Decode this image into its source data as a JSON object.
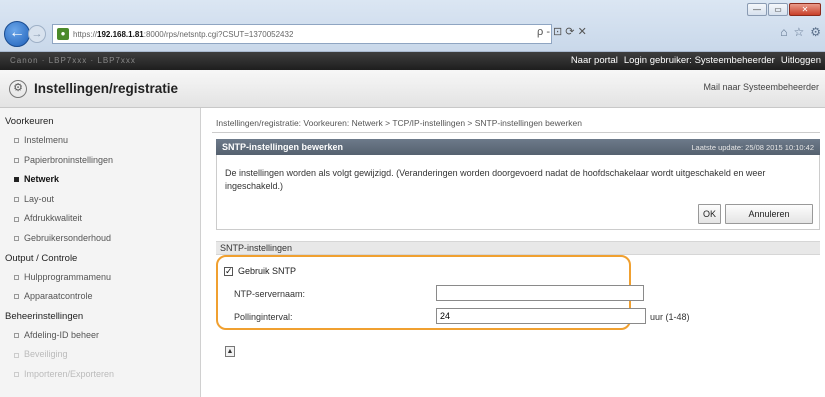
{
  "browser": {
    "url_prefix": "https://",
    "url_host": "192.168.1.81",
    "url_rest": ":8000/rps/netsntp.cgi?CSUT=1370052432",
    "url_tools": "ρ - ⊡ ⟳ ✕",
    "window_buttons": [
      "—",
      "▭",
      "✕"
    ]
  },
  "topbar": {
    "brand": "Canon  ·  LBP7xxx  ·  LBP7xxx",
    "portal_link": "Naar portal",
    "login_text": "Login gebruiker: Systeembeheerder",
    "logout_link": "Uitloggen"
  },
  "header": {
    "title": "Instellingen/registratie",
    "mail_link": "Mail naar Systeembeheerder"
  },
  "sidebar": {
    "sections": [
      {
        "label": "Voorkeuren",
        "items": [
          {
            "label": "Instelmenu",
            "state": "normal"
          },
          {
            "label": "Papierbroninstellingen",
            "state": "normal"
          },
          {
            "label": "Netwerk",
            "state": "active"
          },
          {
            "label": "Lay-out",
            "state": "normal"
          },
          {
            "label": "Afdrukkwaliteit",
            "state": "normal"
          },
          {
            "label": "Gebruikersonderhoud",
            "state": "normal"
          }
        ]
      },
      {
        "label": "Output / Controle",
        "items": [
          {
            "label": "Hulpprogrammamenu",
            "state": "normal"
          },
          {
            "label": "Apparaatcontrole",
            "state": "normal"
          }
        ]
      },
      {
        "label": "Beheerinstellingen",
        "items": [
          {
            "label": "Afdeling-ID beheer",
            "state": "normal"
          },
          {
            "label": "Beveiliging",
            "state": "dim"
          },
          {
            "label": "Importeren/Exporteren",
            "state": "dim"
          }
        ]
      }
    ]
  },
  "main": {
    "breadcrumb": "Instellingen/registratie: Voorkeuren: Netwerk > TCP/IP-instellingen > SNTP-instellingen bewerken",
    "panel_title": "SNTP-instellingen bewerken",
    "last_update": "Laatste update: 25/08 2015 10:10:42",
    "message": "De instellingen worden als volgt gewijzigd. (Veranderingen worden doorgevoerd nadat de hoofdschakelaar wordt uitgeschakeld en weer ingeschakeld.)",
    "ok_label": "OK",
    "cancel_label": "Annuleren",
    "section_title": "SNTP-instellingen",
    "use_sntp_label": "Gebruik SNTP",
    "use_sntp_checked": true,
    "ntp_server_label": "NTP-servernaam:",
    "ntp_server_value": "",
    "polling_label": "Pollinginterval:",
    "polling_value": "24",
    "polling_unit": "uur (1-48)"
  },
  "icons": {
    "back": "back-arrow-icon",
    "forward": "forward-arrow-icon",
    "settings": "settings-gear-icon",
    "page_top": "page-top-icon"
  },
  "colors": {
    "highlight": "#f0a030",
    "panel_head": "#5f6b7a",
    "topbar": "#2a2a2a"
  }
}
